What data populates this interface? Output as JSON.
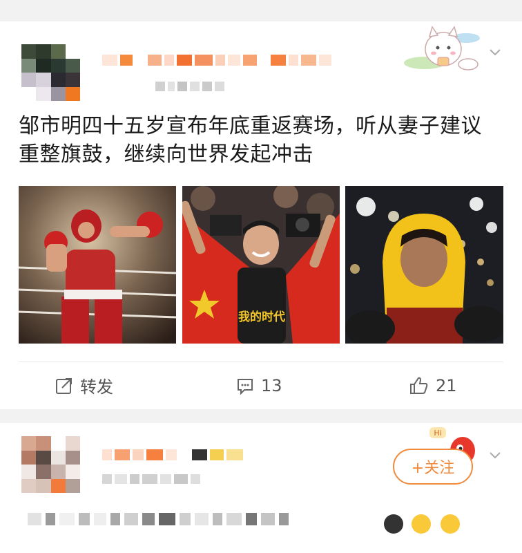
{
  "post": {
    "text": "邹市明四十五岁宣布年底重返赛场，听从妻子建议重整旗鼓，继续向世界发起冲击",
    "photos": [
      {
        "icon": "boxer-training-photo"
      },
      {
        "icon": "boxer-with-flag-photo",
        "shirt_text": "我的时代"
      },
      {
        "icon": "boxer-yellow-hood-photo"
      }
    ],
    "actions": {
      "repost_label": "转发",
      "comment_count": "13",
      "like_count": "21"
    }
  },
  "second_post": {
    "follow_label": "+关注",
    "mascot_badge": "Hi"
  },
  "colors": {
    "accent_orange": "#f08a3c",
    "page_bg": "#f2f2f2"
  }
}
